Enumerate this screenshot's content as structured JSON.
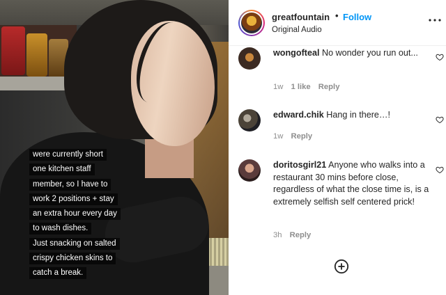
{
  "post": {
    "caption_lines": [
      "were currently short",
      "one kitchen staff",
      "member, so I have to",
      "work 2 positions + stay",
      "an extra hour every day",
      "to wash dishes.",
      "Just snacking on salted",
      "crispy chicken skins to",
      "catch a break."
    ]
  },
  "header": {
    "username": "greatfountain",
    "separator": "•",
    "follow_label": "Follow",
    "audio_label": "Original Audio",
    "icons": {
      "avatar": "profile-avatar",
      "more": "more-options-icon"
    }
  },
  "comments": [
    {
      "username": "wongofteal",
      "text": "No wonder you run out...",
      "time": "1w",
      "likes": "1 like",
      "reply_label": "Reply",
      "avatar_color": "#3b2a22"
    },
    {
      "username": "edward.chik",
      "text": "Hang in there…!",
      "time": "1w",
      "likes": "",
      "reply_label": "Reply",
      "avatar_color": "#4b4338"
    },
    {
      "username": "doritosgirl21",
      "text": "Anyone who walks into a restaurant 30 mins before close, regardless of what the close time is, is a extremely selfish self centered prick!",
      "time": "3h",
      "likes": "",
      "reply_label": "Reply",
      "avatar_color": "#5a3b3b"
    }
  ],
  "colors": {
    "accent": "#0095f6",
    "text": "#262626",
    "muted": "#8e8e8e"
  },
  "icons": {
    "heart": "heart-icon",
    "add": "add-circle-icon"
  }
}
